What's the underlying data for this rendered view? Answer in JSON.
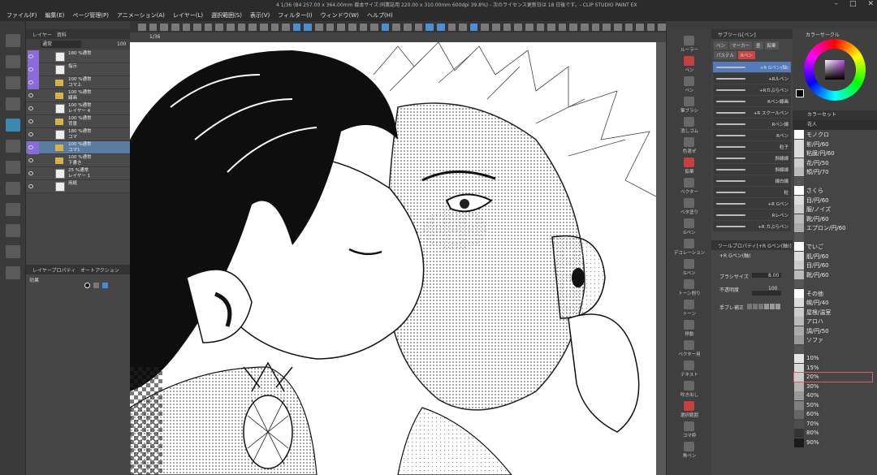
{
  "app": {
    "doc_title": "4 1/36 (B4 257.00 x 364.00mm 裁本サイズ:同業誌用 220.00 x 310.00mm 600dpi 39.8%) - 次のライセンス更新日は 18 日後です。- CLIP STUDIO PAINT EX"
  },
  "menu": [
    "ファイル(F)",
    "編集(E)",
    "ページ管理(P)",
    "アニメーション(A)",
    "レイヤー(L)",
    "選択範囲(S)",
    "表示(V)",
    "フィルター(I)",
    "ウィンドウ(W)",
    "ヘルプ(H)"
  ],
  "layer_panel": {
    "tabs": [
      "レイヤー",
      "資料"
    ],
    "blend_mode": "通常",
    "opacity": "100",
    "layers": [
      {
        "line1": "180 %通常",
        "line2": ""
      },
      {
        "line1": "指示",
        "line2": ""
      },
      {
        "line1": "100 %通常",
        "line2": "コマ上"
      },
      {
        "line1": "100 %通常",
        "line2": "線画"
      },
      {
        "line1": "100 %通常",
        "line2": "レイヤー 4"
      },
      {
        "line1": "100 %通常",
        "line2": "背景"
      },
      {
        "line1": "180 %通常",
        "line2": "コマ"
      },
      {
        "line1": "100 %通常",
        "line2": "コマ1"
      },
      {
        "line1": "100 %通常",
        "line2": "下書き"
      },
      {
        "line1": "25 %通常",
        "line2": "レイヤー 1"
      },
      {
        "line1": "用紙",
        "line2": ""
      }
    ]
  },
  "left_property": {
    "tabs": [
      "レイヤープロパティ",
      "オートアクション"
    ],
    "effect_label": "効果"
  },
  "canvas": {
    "tab_label": "1/36"
  },
  "sub_tools": [
    {
      "label": "ルーラー",
      "red": false
    },
    {
      "label": "ペン",
      "red": true
    },
    {
      "label": "ペン",
      "red": false
    },
    {
      "label": "筆ブラシ",
      "red": false
    },
    {
      "label": "消しゴム",
      "red": false
    },
    {
      "label": "色混ぜ",
      "red": false
    },
    {
      "label": "鉛筆",
      "red": true
    },
    {
      "label": "ベクター",
      "red": false
    },
    {
      "label": "ベタ塗り",
      "red": false
    },
    {
      "label": "Gペン",
      "red": false
    },
    {
      "label": "デコレーション",
      "red": false
    },
    {
      "label": "Gペン",
      "red": false
    },
    {
      "label": "トーン削り",
      "red": false
    },
    {
      "label": "トーン",
      "red": false
    },
    {
      "label": "移動",
      "red": false
    },
    {
      "label": "ベクター用",
      "red": false
    },
    {
      "label": "テキスト",
      "red": false
    },
    {
      "label": "吹き出し",
      "red": false
    },
    {
      "label": "選択範囲",
      "red": true
    },
    {
      "label": "コマ枠",
      "red": false
    },
    {
      "label": "角ペン",
      "red": false
    }
  ],
  "brush_panel": {
    "title": "サブツール[ペン]",
    "categories": [
      "ペン",
      "マーカー",
      "墨",
      "鉛筆",
      "パステル",
      "Rペン"
    ],
    "brushes": [
      "+R Gペン(軸)",
      "+Rルペン",
      "+Rカぶらペン",
      "Rペン線画",
      "+R スクールペン",
      "Rペン線",
      "Rペン",
      "粒子",
      "斜線線",
      "斜線線",
      "線白線",
      "粒",
      "+R Gペン",
      "Rレペン",
      "+R カぶらペン"
    ],
    "active_index": 0
  },
  "tool_property": {
    "title": "ツールプロパティ[+R Gペン(軸)]",
    "brush_name": "+R Gペン(軸)",
    "size_label": "ブラシサイズ",
    "size_value": "8.00",
    "opacity_label": "不透明度",
    "opacity_value": "100",
    "stabilizer_label": "手ブレ補正"
  },
  "color_panel": {
    "title": "カラーサークル"
  },
  "colorset": {
    "title": "カラーセット",
    "set_name": "花人",
    "items": [
      {
        "name": "モノクロ",
        "color": "#ffffff"
      },
      {
        "name": "影/円/60",
        "color": "#dddddd"
      },
      {
        "name": "粘膜/円/60",
        "color": "#dddddd"
      },
      {
        "name": "花/円/50",
        "color": "#cccccc"
      },
      {
        "name": "頬/円/70",
        "color": "#bbbbbb"
      },
      {
        "name": "",
        "color": "#555555"
      },
      {
        "name": "さくら",
        "color": "#ffffff"
      },
      {
        "name": "目/円/60",
        "color": "#dddddd"
      },
      {
        "name": "服/ノイズ",
        "color": "#cccccc"
      },
      {
        "name": "靴/円/60",
        "color": "#bbbbbb"
      },
      {
        "name": "エプロン/円/60",
        "color": "#aaaaaa"
      },
      {
        "name": "",
        "color": "#555555"
      },
      {
        "name": "でいご",
        "color": "#ffffff"
      },
      {
        "name": "肌/円/60",
        "color": "#dddddd"
      },
      {
        "name": "目/円/60",
        "color": "#cccccc"
      },
      {
        "name": "靴/円/60",
        "color": "#bbbbbb"
      },
      {
        "name": "",
        "color": "#555555"
      },
      {
        "name": "その他",
        "color": "#ffffff"
      },
      {
        "name": "幌/円/40",
        "color": "#dddddd"
      },
      {
        "name": "屋根/温室",
        "color": "#cccccc"
      },
      {
        "name": "アロハ",
        "color": "#bbbbbb"
      },
      {
        "name": "調/円/50",
        "color": "#aaaaaa"
      },
      {
        "name": "ソファ",
        "color": "#999999"
      },
      {
        "name": "",
        "color": "#555555"
      },
      {
        "name": "10%",
        "color": "#e6e6e6"
      },
      {
        "name": "15%",
        "color": "#d9d9d9"
      },
      {
        "name": "20%",
        "color": "#cccccc"
      },
      {
        "name": "30%",
        "color": "#b3b3b3"
      },
      {
        "name": "40%",
        "color": "#999999"
      },
      {
        "name": "50%",
        "color": "#808080"
      },
      {
        "name": "60%",
        "color": "#666666"
      },
      {
        "name": "70%",
        "color": "#4d4d4d"
      },
      {
        "name": "80%",
        "color": "#333333"
      },
      {
        "name": "90%",
        "color": "#1a1a1a"
      }
    ],
    "highlighted": "20%"
  }
}
